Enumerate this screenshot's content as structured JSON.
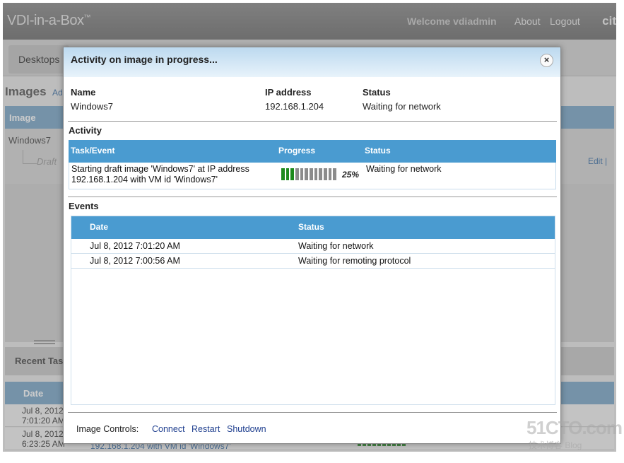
{
  "header": {
    "brand": "VDI-in-a-Box",
    "brand_mark": "™",
    "welcome": "Welcome vdiadmin",
    "about": "About",
    "logout": "Logout",
    "logo_partial": "cit"
  },
  "nav": {
    "desktops": "Desktops"
  },
  "images_page": {
    "title": "Images",
    "add_partial": "Ad",
    "column_image": "Image",
    "row_name": "Windows7",
    "row_draft": "Draft",
    "edit_partial": "Edit |"
  },
  "recent_tasks": {
    "title": "Recent Tasl",
    "column_date": "Date",
    "rows": [
      {
        "date_line1": "Jul 8, 2012",
        "date_line2": "7:01:20 AM"
      },
      {
        "date_line1": "Jul 8, 2012",
        "date_line2": "6:23:25 AM"
      }
    ],
    "bottom_link_partial": "192.168.1.204 with VM id 'Windows7'"
  },
  "modal": {
    "title": "Activity on image in progress...",
    "close_glyph": "×",
    "info": {
      "name_label": "Name",
      "name_value": "Windows7",
      "ip_label": "IP address",
      "ip_value": "192.168.1.204",
      "status_label": "Status",
      "status_value": "Waiting for network"
    },
    "activity": {
      "section_title": "Activity",
      "headers": {
        "task": "Task/Event",
        "progress": "Progress",
        "status": "Status"
      },
      "row": {
        "task_line1": "Starting draft image 'Windows7' at IP address",
        "task_line2": "192.168.1.204 with VM id 'Windows7'",
        "progress_fraction": 0.25,
        "progress_text": "25%",
        "status": "Waiting for network"
      }
    },
    "events": {
      "section_title": "Events",
      "headers": {
        "date": "Date",
        "status": "Status"
      },
      "rows": [
        {
          "date": "Jul 8, 2012 7:01:20 AM",
          "status": "Waiting for network"
        },
        {
          "date": "Jul 8, 2012 7:00:56 AM",
          "status": "Waiting for remoting protocol"
        }
      ]
    },
    "controls": {
      "label": "Image Controls:",
      "connect": "Connect",
      "restart": "Restart",
      "shutdown": "Shutdown"
    }
  },
  "watermark": {
    "line1": "51CTO.com",
    "line2": "技术博客  Blog"
  },
  "colors": {
    "header_bg": "#7a7a7a",
    "table_head": "#4a9bd0",
    "progress_on": "#1d8a1d",
    "progress_off": "#8c8c8c",
    "link": "#1f3f8f"
  }
}
